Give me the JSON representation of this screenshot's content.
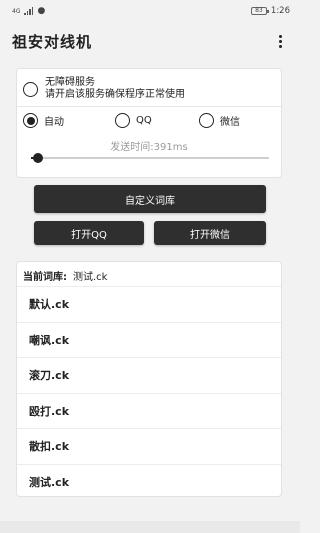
{
  "status_bar": {
    "network_label": "4G",
    "battery_level": "83",
    "time": "1:26"
  },
  "app": {
    "title": "祖安对线机"
  },
  "settings": {
    "accessibility": {
      "title": "无障碍服务",
      "description": "请开启该服务确保程序正常使用",
      "checked": false
    },
    "modes": [
      {
        "label": "自动",
        "checked": true
      },
      {
        "label": "QQ",
        "checked": false
      },
      {
        "label": "微信",
        "checked": false
      }
    ],
    "send_time_label": "发送时间:391ms",
    "send_time_slider_fraction": 0.03
  },
  "buttons": {
    "custom_lexicon": "自定义词库",
    "open_qq": "打开QQ",
    "open_wechat": "打开微信"
  },
  "lexicon": {
    "current_label": "当前词库:",
    "current_value": "测试.ck",
    "items": [
      "默认.ck",
      "嘲讽.ck",
      "滚刀.ck",
      "殴打.ck",
      "散扣.ck",
      "测试.ck"
    ]
  }
}
